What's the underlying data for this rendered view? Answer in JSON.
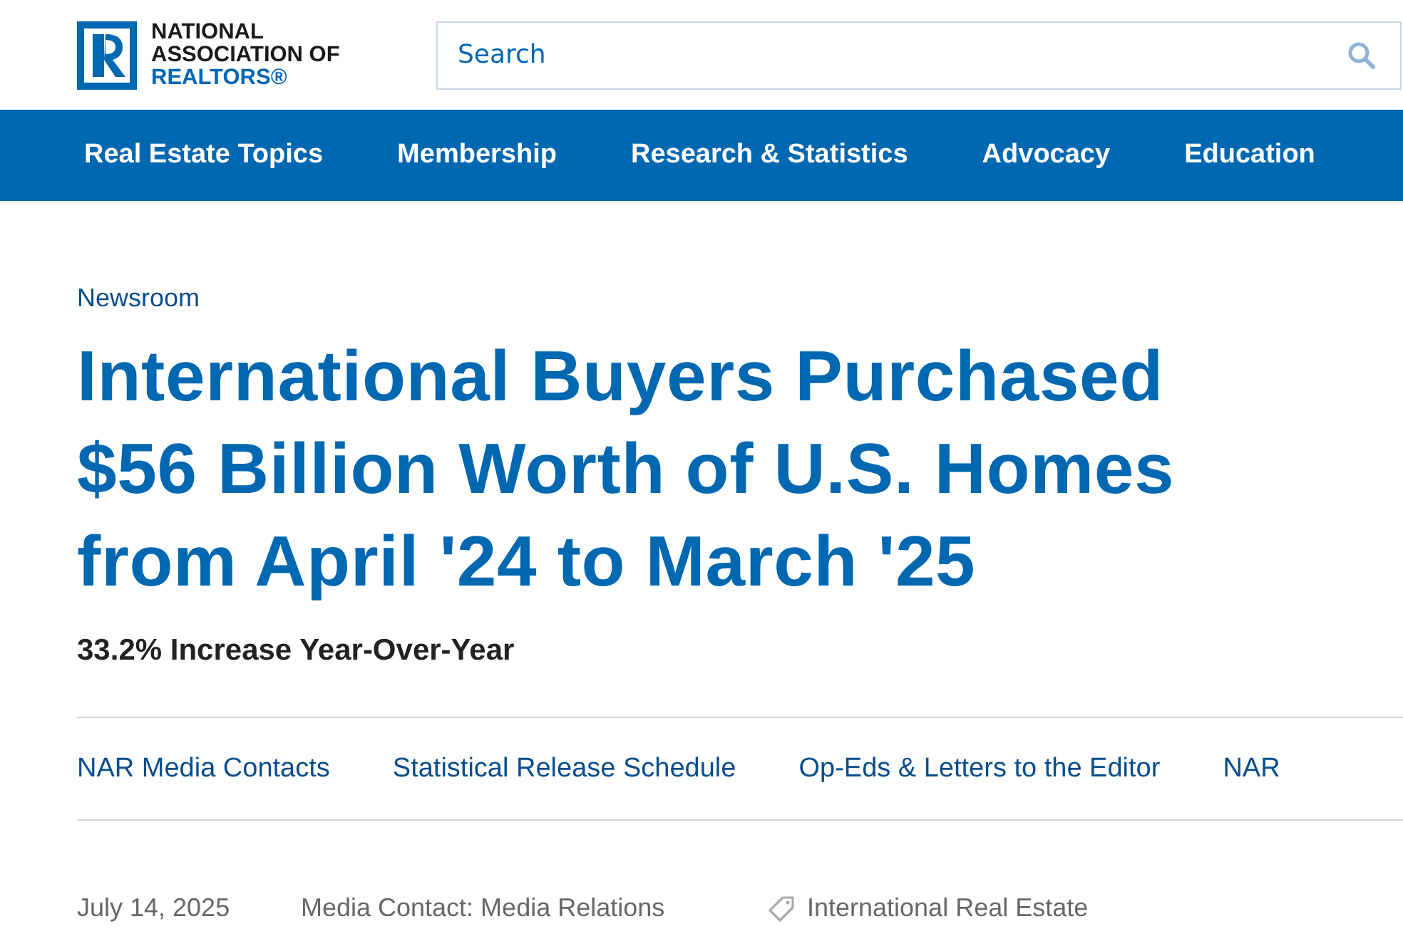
{
  "logo": {
    "lines": [
      "NATIONAL",
      "ASSOCIATION OF",
      "REALTORS®"
    ]
  },
  "search": {
    "placeholder": "Search"
  },
  "nav": [
    {
      "label": "Real Estate Topics"
    },
    {
      "label": "Membership"
    },
    {
      "label": "Research & Statistics"
    },
    {
      "label": "Advocacy"
    },
    {
      "label": "Education"
    }
  ],
  "breadcrumb": "Newsroom",
  "headline": "International Buyers Purchased $56 Billion Worth of U.S. Homes from April '24 to March '25",
  "subheadline": "33.2% Increase Year-Over-Year",
  "links": [
    {
      "label": "NAR Media Contacts"
    },
    {
      "label": "Statistical Release Schedule"
    },
    {
      "label": "Op-Eds & Letters to the Editor"
    },
    {
      "label": "NAR"
    }
  ],
  "meta": {
    "date": "July 14, 2025",
    "contact": "Media Contact: Media Relations",
    "tag": "International Real Estate"
  }
}
